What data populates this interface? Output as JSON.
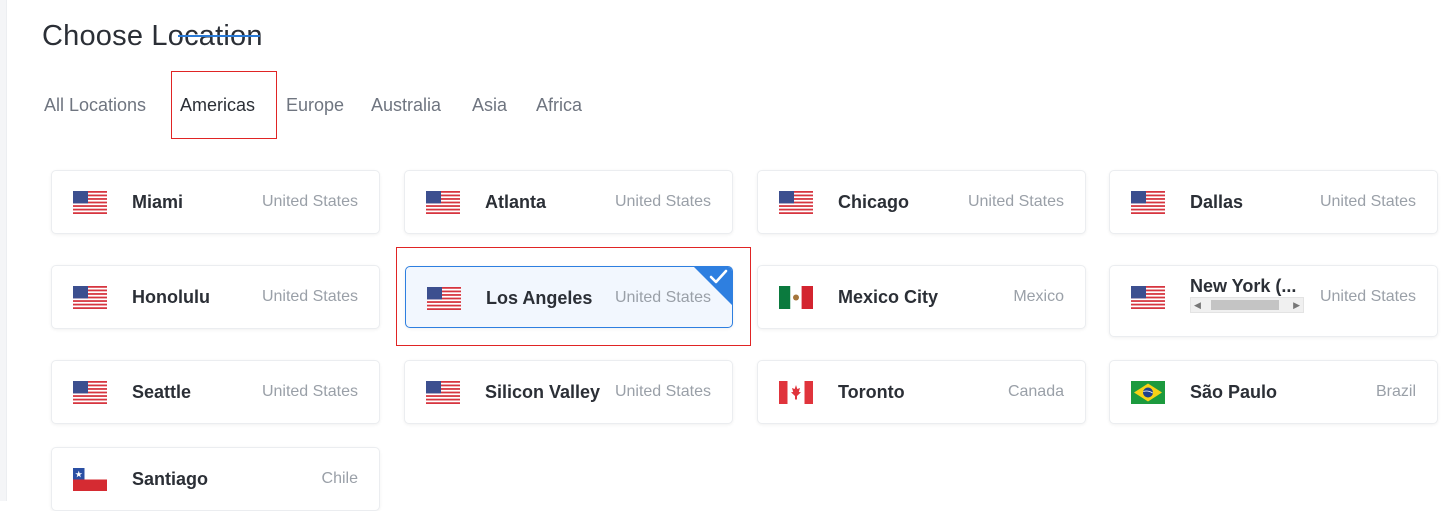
{
  "title": "Choose Location",
  "tabs": [
    {
      "label": "All Locations",
      "active": false
    },
    {
      "label": "Americas",
      "active": true
    },
    {
      "label": "Europe",
      "active": false
    },
    {
      "label": "Australia",
      "active": false
    },
    {
      "label": "Asia",
      "active": false
    },
    {
      "label": "Africa",
      "active": false
    }
  ],
  "locations": [
    {
      "city": "Miami",
      "country": "United States",
      "flag": "us-flag-icon"
    },
    {
      "city": "Atlanta",
      "country": "United States",
      "flag": "us-flag-icon"
    },
    {
      "city": "Chicago",
      "country": "United States",
      "flag": "us-flag-icon"
    },
    {
      "city": "Dallas",
      "country": "United States",
      "flag": "us-flag-icon"
    },
    {
      "city": "Honolulu",
      "country": "United States",
      "flag": "us-flag-icon"
    },
    {
      "city": "Los Angeles",
      "country": "United States",
      "flag": "us-flag-icon",
      "selected": true
    },
    {
      "city": "Mexico City",
      "country": "Mexico",
      "flag": "mexico-flag-icon"
    },
    {
      "city": "New York (...",
      "country": "United States",
      "flag": "us-flag-icon"
    },
    {
      "city": "Seattle",
      "country": "United States",
      "flag": "us-flag-icon"
    },
    {
      "city": "Silicon Valley",
      "country": "United States",
      "flag": "us-flag-icon"
    },
    {
      "city": "Toronto",
      "country": "Canada",
      "flag": "canada-flag-icon"
    },
    {
      "city": "São Paulo",
      "country": "Brazil",
      "flag": "brazil-flag-icon"
    },
    {
      "city": "Santiago",
      "country": "Chile",
      "flag": "chile-flag-icon"
    }
  ],
  "colors": {
    "accent": "#2e7fe0",
    "highlight": "#e02424",
    "selected_bg": "#f2f7fe"
  }
}
